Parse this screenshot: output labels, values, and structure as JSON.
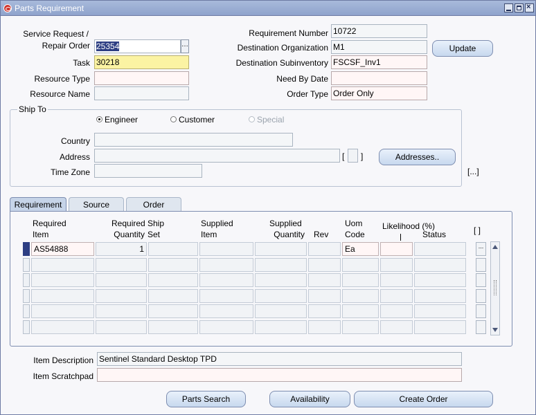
{
  "window": {
    "title": "Parts Requirement"
  },
  "header": {
    "service_request_label_1": "Service Request /",
    "service_request_label_2": "Repair Order",
    "service_request_value": "25354",
    "task_label": "Task",
    "task_value": "30218",
    "resource_type_label": "Resource Type",
    "resource_type_value": "",
    "resource_name_label": "Resource Name",
    "resource_name_value": "",
    "requirement_number_label": "Requirement Number",
    "requirement_number_value": "10722",
    "dest_org_label": "Destination Organization",
    "dest_org_value": "M1",
    "dest_subinv_label": "Destination Subinventory",
    "dest_subinv_value": "FSCSF_Inv1",
    "need_by_label": "Need By Date",
    "need_by_value": "",
    "order_type_label": "Order Type",
    "order_type_value": "Order Only",
    "update_button": "Update"
  },
  "ship_to": {
    "group_label": "Ship To",
    "radio_engineer": "Engineer",
    "radio_customer": "Customer",
    "radio_special": "Special",
    "country_label": "Country",
    "country_value": "",
    "address_label": "Address",
    "address_value": "",
    "timezone_label": "Time Zone",
    "timezone_value": "",
    "addresses_button": "Addresses..",
    "bracket_left": "[",
    "bracket_right": "]",
    "outer_dots": "[...]"
  },
  "tabs": [
    {
      "label": "Requirement"
    },
    {
      "label": "Source"
    },
    {
      "label": "Order"
    }
  ],
  "table": {
    "headers": {
      "required_item_1": "Required",
      "required_item_2": "Item",
      "required_qty_1": "Required",
      "required_qty_2": "Quantity",
      "ship_set_1": "Ship",
      "ship_set_2": "Set",
      "supplied_item_1": "Supplied",
      "supplied_item_2": "Item",
      "supplied_qty_1": "Supplied",
      "supplied_qty_2": "Quantity",
      "rev": "Rev",
      "uom_1": "Uom",
      "uom_2": "Code",
      "likelihood": "Likelihood (%)",
      "status": "Status",
      "folder": "[ ]"
    },
    "rows": [
      {
        "required_item": "AS54888",
        "required_qty": "1",
        "uom": "Ea"
      },
      {
        "required_item": "",
        "required_qty": "",
        "uom": ""
      },
      {
        "required_item": "",
        "required_qty": "",
        "uom": ""
      },
      {
        "required_item": "",
        "required_qty": "",
        "uom": ""
      },
      {
        "required_item": "",
        "required_qty": "",
        "uom": ""
      },
      {
        "required_item": "",
        "required_qty": "",
        "uom": ""
      }
    ]
  },
  "footer": {
    "item_description_label": "Item Description",
    "item_description_value": "Sentinel Standard Desktop TPD",
    "item_scratchpad_label": "Item Scratchpad",
    "item_scratchpad_value": "",
    "parts_search_button": "Parts Search",
    "availability_button": "Availability",
    "create_order_button": "Create Order"
  }
}
